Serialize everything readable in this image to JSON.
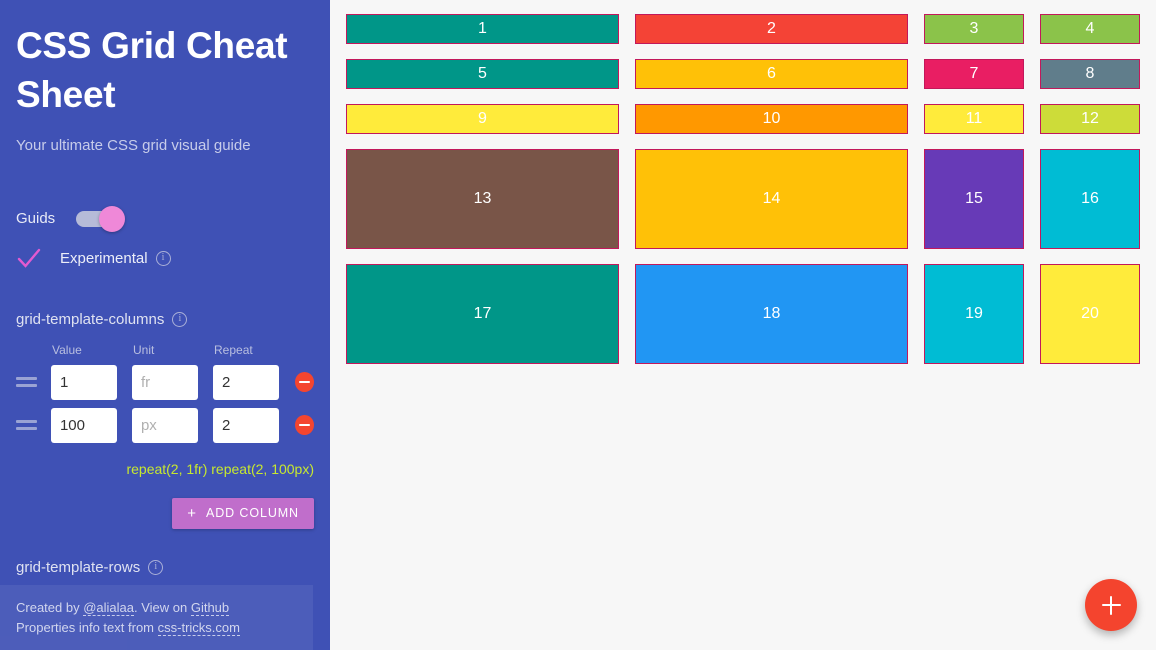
{
  "sidebar": {
    "title": "CSS Grid Cheat Sheet",
    "subtitle": "Your ultimate CSS grid visual guide",
    "guides": {
      "label": "Guids",
      "enabled": true
    },
    "experimental": {
      "label": "Experimental",
      "checked": true,
      "info": "i"
    },
    "columns_section": {
      "title": "grid-template-columns",
      "info": "i",
      "headers": {
        "value": "Value",
        "unit": "Unit",
        "repeat": "Repeat"
      },
      "rows": [
        {
          "value": "1",
          "unit_placeholder": "fr",
          "unit": "",
          "repeat": "2"
        },
        {
          "value": "100",
          "unit_placeholder": "px",
          "unit": "",
          "repeat": "2"
        }
      ],
      "result": "repeat(2, 1fr) repeat(2, 100px)",
      "add_label": "ADD COLUMN",
      "add_plus": "+"
    },
    "rows_section": {
      "title": "grid-template-rows",
      "info": "i"
    },
    "footer": {
      "line1_prefix": "Created by ",
      "author": "@alialaa",
      "line1_mid": ". View on ",
      "github": "Github",
      "line2_prefix": "Properties info text from ",
      "source": "css-tricks.com"
    }
  },
  "stage": {
    "fab_label": "+",
    "cell_border_color": "#c2185b",
    "background": "#f7f7f7",
    "cells": [
      {
        "label": "1",
        "color": "#009688"
      },
      {
        "label": "2",
        "color": "#f44336"
      },
      {
        "label": "3",
        "color": "#8bc34a"
      },
      {
        "label": "4",
        "color": "#8bc34a"
      },
      {
        "label": "5",
        "color": "#009688"
      },
      {
        "label": "6",
        "color": "#ffc107"
      },
      {
        "label": "7",
        "color": "#e91e63"
      },
      {
        "label": "8",
        "color": "#607d8b"
      },
      {
        "label": "9",
        "color": "#ffeb3b"
      },
      {
        "label": "10",
        "color": "#ff9800"
      },
      {
        "label": "11",
        "color": "#ffeb3b"
      },
      {
        "label": "12",
        "color": "#cddc39"
      },
      {
        "label": "13",
        "color": "#795548"
      },
      {
        "label": "14",
        "color": "#ffc107"
      },
      {
        "label": "15",
        "color": "#673ab7"
      },
      {
        "label": "16",
        "color": "#00bcd4"
      },
      {
        "label": "17",
        "color": "#009688"
      },
      {
        "label": "18",
        "color": "#2196f3"
      },
      {
        "label": "19",
        "color": "#00bcd4"
      },
      {
        "label": "20",
        "color": "#ffeb3b"
      }
    ]
  }
}
